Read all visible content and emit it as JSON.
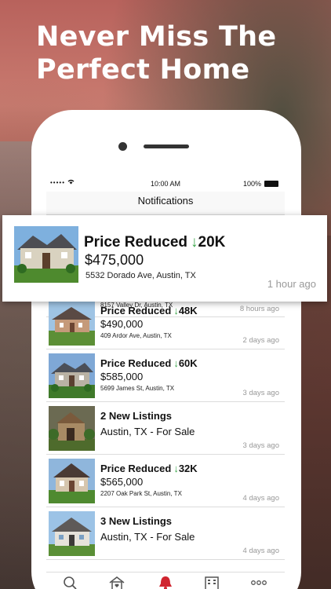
{
  "headline": {
    "line1": "Never Miss The",
    "line2": "Perfect Home"
  },
  "status_bar": {
    "carrier": "•••••",
    "time": "10:00 AM",
    "battery": "100%"
  },
  "nav": {
    "title": "Notifications"
  },
  "featured": {
    "title": "Price Reduced",
    "arrow": "↓",
    "amount": "20K",
    "price": "$475,000",
    "address": "5532 Dorado Ave, Austin, TX",
    "time": "1 hour ago"
  },
  "partial_row": {
    "address": "8157 Valley Dr, Austin, TX",
    "time": "8 hours ago"
  },
  "notifications": [
    {
      "title": "Price Reduced",
      "arrow": "↓",
      "amount": "48K",
      "price": "$490,000",
      "address": "409 Ardor Ave, Austin, TX",
      "time": "2 days ago"
    },
    {
      "title": "Price Reduced",
      "arrow": "↓",
      "amount": "60K",
      "price": "$585,000",
      "address": "5699 James St, Austin, TX",
      "time": "3 days ago"
    },
    {
      "title": "2 New Listings",
      "subtitle": "Austin, TX - For Sale",
      "time": "3 days ago"
    },
    {
      "title": "Price Reduced",
      "arrow": "↓",
      "amount": "32K",
      "price": "$565,000",
      "address": "2207 Oak Park St, Austin, TX",
      "time": "4 days ago"
    },
    {
      "title": "3 New Listings",
      "subtitle": "Austin, TX - For Sale",
      "time": "4 days ago"
    }
  ],
  "tabs": [
    {
      "icon": "search-icon"
    },
    {
      "icon": "home-heart-icon"
    },
    {
      "icon": "bell-icon",
      "active": true
    },
    {
      "icon": "building-icon"
    },
    {
      "icon": "more-icon"
    }
  ],
  "colors": {
    "accent_red": "#d0242f",
    "arrow_green": "#3aa64a",
    "muted_text": "#999999"
  }
}
